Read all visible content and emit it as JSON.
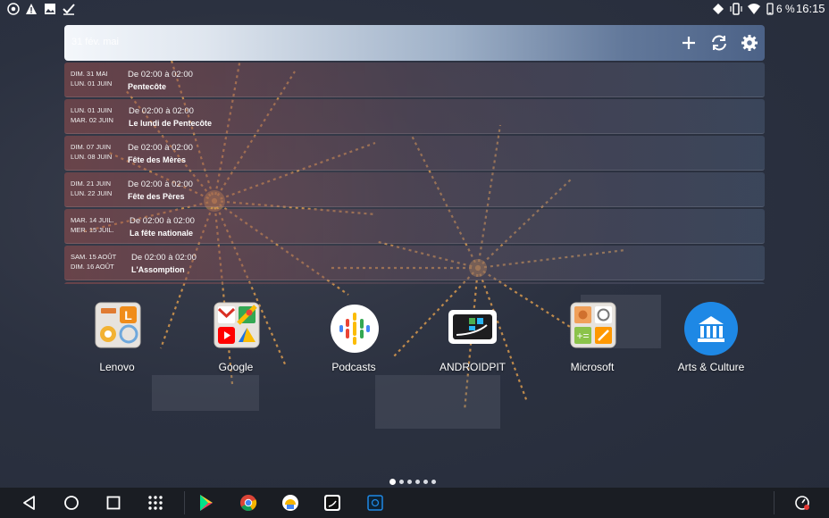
{
  "status_bar": {
    "left_icons": [
      "chrome-icon",
      "warning-icon",
      "image-icon",
      "checkmark-icon"
    ],
    "right_icons": [
      "mobile-data-icon",
      "vibrate-icon",
      "wifi-icon",
      "battery-icon"
    ],
    "battery": "6 %",
    "time": "16:15"
  },
  "widget": {
    "month_label": "31 fév. mai",
    "add_icon": "plus-icon",
    "sync_icon": "sync-icon",
    "settings_icon": "gear-icon",
    "events": [
      {
        "date_start": "DIM. 31 MAI",
        "date_end": "LUN. 01 JUIN",
        "time": "De 02:00 à 02:00",
        "title": "Pentecôte"
      },
      {
        "date_start": "LUN. 01 JUIN",
        "date_end": "MAR. 02 JUIN",
        "time": "De 02:00 à 02:00",
        "title": "Le lundi de Pentecôte"
      },
      {
        "date_start": "DIM. 07 JUIN",
        "date_end": "LUN. 08 JUIN",
        "time": "De 02:00 à 02:00",
        "title": "Fête des Mères"
      },
      {
        "date_start": "DIM. 21 JUIN",
        "date_end": "LUN. 22 JUIN",
        "time": "De 02:00 à 02:00",
        "title": "Fête des Pères"
      },
      {
        "date_start": "MAR. 14 JUIL.",
        "date_end": "MER. 15 JUIL.",
        "time": "De 02:00 à 02:00",
        "title": "La fête nationale"
      },
      {
        "date_start": "SAM. 15 AOÛT",
        "date_end": "DIM. 16 AOÛT",
        "time": "De 02:00 à 02:00",
        "title": "L'Assomption"
      }
    ]
  },
  "apps": [
    {
      "label": "Lenovo",
      "icon": "lenovo-folder-icon"
    },
    {
      "label": "Google",
      "icon": "google-folder-icon"
    },
    {
      "label": "Podcasts",
      "icon": "podcasts-icon"
    },
    {
      "label": "ANDROIDPIT",
      "icon": "androidpit-icon"
    },
    {
      "label": "Microsoft",
      "icon": "microsoft-folder-icon"
    },
    {
      "label": "Arts & Culture",
      "icon": "arts-culture-icon"
    }
  ],
  "pages": {
    "count": 6,
    "active": 1
  },
  "nav_bar": {
    "buttons": [
      "back-icon",
      "home-icon",
      "recents-icon",
      "app-drawer-icon"
    ],
    "pinned_apps": [
      "play-store-icon",
      "chrome-icon",
      "app-icon",
      "androidpit-icon",
      "app-icon"
    ],
    "right_icon": "speed-icon"
  },
  "colors": {
    "accent_blue": "#1e88e5",
    "nav_bg": "#1a1d23"
  }
}
